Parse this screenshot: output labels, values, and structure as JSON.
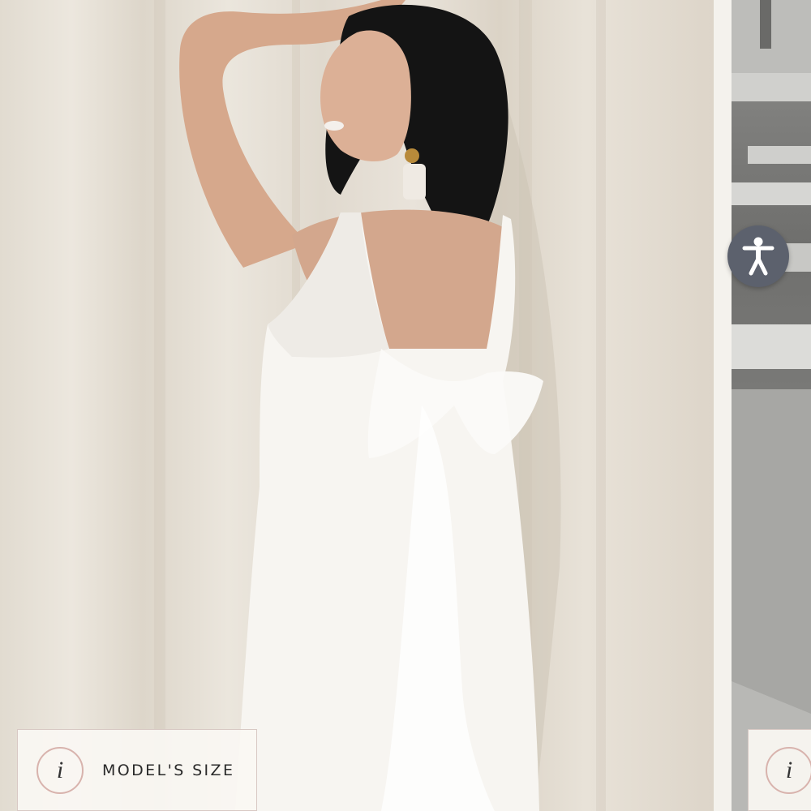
{
  "gallery": {
    "slides": [
      {
        "image_alt": "",
        "badge": {
          "icon": "info-icon",
          "icon_glyph": "i",
          "label": "MODEL'S SIZE"
        }
      },
      {
        "image_alt": "",
        "badge": {
          "icon": "info-icon",
          "icon_glyph": "i"
        }
      }
    ]
  },
  "accessibility": {
    "icon": "accessibility-person-icon",
    "button_color": "#5c616d"
  },
  "colors": {
    "background": "#f3f1ec",
    "badge_border": "#d8c9c4",
    "info_ring": "#d8b3ad"
  }
}
